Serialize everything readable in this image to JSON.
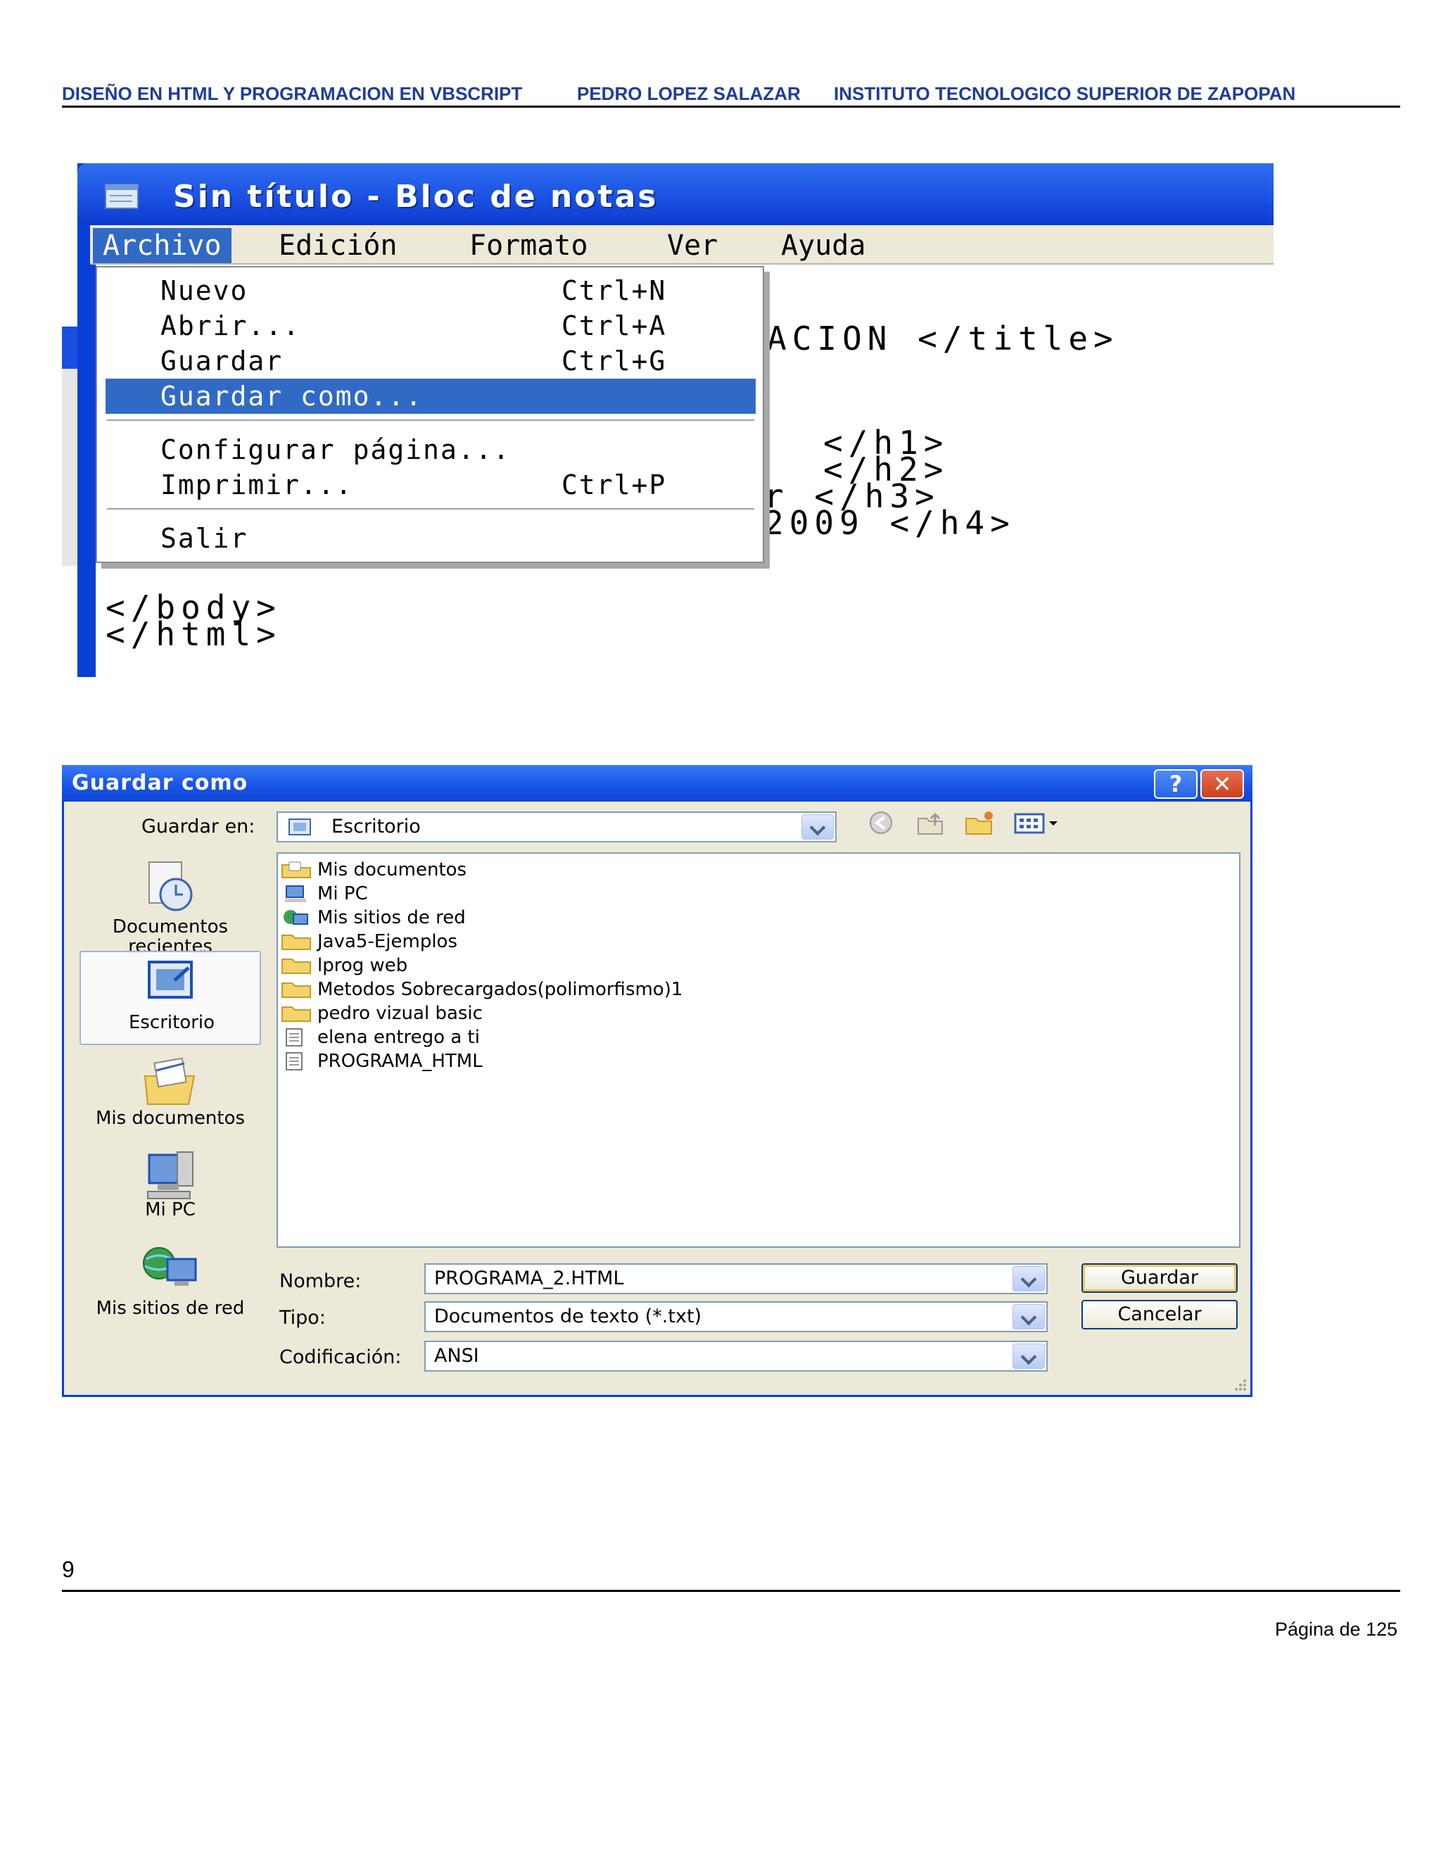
{
  "header": {
    "left": "DISEÑO EN HTML Y PROGRAMACION EN  VBSCRIPT",
    "center": "PEDRO LOPEZ SALAZAR",
    "right": "INSTITUTO  TECNOLOGICO SUPERIOR DE ZAPOPAN"
  },
  "notepad": {
    "title": "Sin título - Bloc de notas",
    "menu": [
      "Archivo",
      "Edición",
      "Formato",
      "Ver",
      "Ayuda"
    ],
    "file_menu": [
      {
        "label": "Nuevo",
        "shortcut": "Ctrl+N"
      },
      {
        "label": "Abrir...",
        "shortcut": "Ctrl+A"
      },
      {
        "label": "Guardar",
        "shortcut": "Ctrl+G"
      },
      {
        "label": "Guardar como...",
        "shortcut": ""
      },
      {
        "label": "Configurar página...",
        "shortcut": ""
      },
      {
        "label": "Imprimir...",
        "shortcut": "Ctrl+P"
      },
      {
        "label": "Salir",
        "shortcut": ""
      }
    ],
    "code_fragments": {
      "title_tail": "ACION </title>",
      "h1_tail": "</h1>",
      "h2_tail": "</h2>",
      "h3_tail": "r </h3>",
      "h4_tail": "2009 </h4>",
      "body_close": "</body>",
      "html_close": "</html>"
    }
  },
  "dialog": {
    "title": "Guardar como",
    "help_button": "?",
    "close_button": "✕",
    "save_in_label": "Guardar en:",
    "save_in_value": "Escritorio",
    "places": [
      {
        "label": "Documentos recientes",
        "icon": "recent-documents-icon"
      },
      {
        "label": "Escritorio",
        "icon": "desktop-icon"
      },
      {
        "label": "Mis documentos",
        "icon": "my-documents-icon"
      },
      {
        "label": "Mi PC",
        "icon": "my-computer-icon"
      },
      {
        "label": "Mis sitios de red",
        "icon": "network-places-icon"
      }
    ],
    "files": [
      {
        "name": "Mis documentos",
        "icon": "my-documents-folder-icon"
      },
      {
        "name": "Mi PC",
        "icon": "my-computer-icon"
      },
      {
        "name": "Mis sitios de red",
        "icon": "network-places-icon"
      },
      {
        "name": "Java5-Ejemplos",
        "icon": "folder-icon"
      },
      {
        "name": "lprog web",
        "icon": "folder-icon"
      },
      {
        "name": "Metodos Sobrecargados(polimorfismo)1",
        "icon": "folder-icon"
      },
      {
        "name": "pedro vizual basic",
        "icon": "folder-icon"
      },
      {
        "name": "elena entrego a ti",
        "icon": "text-file-icon"
      },
      {
        "name": "PROGRAMA_HTML",
        "icon": "text-file-icon"
      }
    ],
    "name_label": "Nombre:",
    "name_value": "PROGRAMA_2.HTML",
    "type_label": "Tipo:",
    "type_value": "Documentos de texto (*.txt)",
    "encoding_label": "Codificación:",
    "encoding_value": "ANSI",
    "save_button": "Guardar",
    "cancel_button": "Cancelar"
  },
  "footer": {
    "page_number": "9",
    "page_of": "Página  de 125"
  }
}
